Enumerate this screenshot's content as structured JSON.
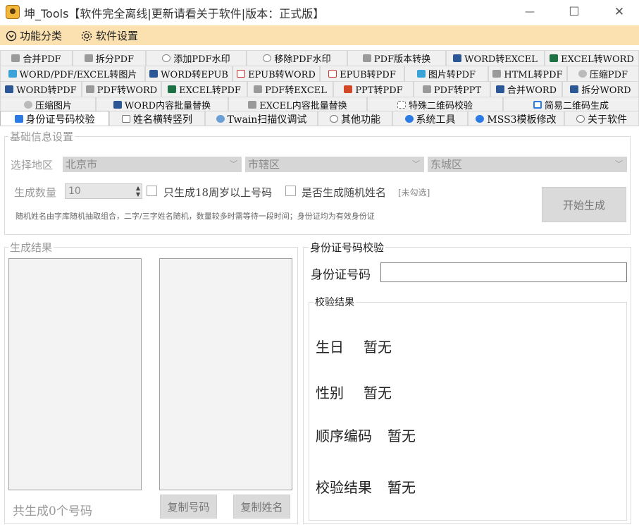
{
  "window": {
    "title": "坤_Tools【软件完全离线|更新请看关于软件|版本：正式版】",
    "minimize": "—",
    "maximize": "☐",
    "close": "✕"
  },
  "menu": {
    "func_category": "功能分类",
    "settings": "软件设置"
  },
  "tabs": {
    "row1": [
      "合并PDF",
      "拆分PDF",
      "添加PDF水印",
      "移除PDF水印",
      "PDF版本转换",
      "WORD转EXCEL",
      "EXCEL转WORD"
    ],
    "row2": [
      "WORD/PDF/EXCEL转图片",
      "WORD转EPUB",
      "EPUB转WORD",
      "EPUB转PDF",
      "图片转PDF",
      "HTML转PDF",
      "压缩PDF"
    ],
    "row3": [
      "WORD转PDF",
      "PDF转WORD",
      "EXCEL转PDF",
      "PDF转EXCEL",
      "PPT转PDF",
      "PDF转PPT",
      "合并WORD",
      "拆分WORD"
    ],
    "row4": [
      "压缩图片",
      "WORD内容批量替换",
      "EXCEL内容批量替换",
      "特殊二维码校验",
      "简易二维码生成"
    ],
    "row5": [
      "身份证号码校验",
      "姓名横转竖列",
      "Twain扫描仪调试",
      "其他功能",
      "系统工具",
      "MSS3模板修改",
      "关于软件"
    ]
  },
  "basic": {
    "title": "基础信息设置",
    "region_label": "选择地区",
    "province": "北京市",
    "city": "市辖区",
    "district": "东城区",
    "count_label": "生成数量",
    "count_value": "10",
    "only18_label": "只生成18周岁以上号码",
    "random_name_label": "是否生成随机姓名",
    "random_name_hint": "[未勾选]",
    "note": "随机姓名由字库随机抽取组合，二字/三字姓名随机，数量较多时需等待一段时间；身份证均为有效身份证",
    "start_button": "开始生成"
  },
  "results": {
    "title": "生成结果",
    "total": "共生成0个号码",
    "copy_numbers": "复制号码",
    "copy_names": "复制姓名"
  },
  "verify": {
    "title": "身份证号码校验",
    "id_label": "身份证号码",
    "id_value": "",
    "result_title": "校验结果",
    "birthday_label": "生日",
    "birthday_value": "暂无",
    "gender_label": "性别",
    "gender_value": "暂无",
    "sequence_label": "顺序编码",
    "sequence_value": "暂无",
    "result_label": "校验结果",
    "result_value": "暂无"
  },
  "colors": {
    "menubar": "#fbe1b0",
    "tab_bg": "#f0f0f0",
    "disabled_combo": "#d6d6d6"
  }
}
